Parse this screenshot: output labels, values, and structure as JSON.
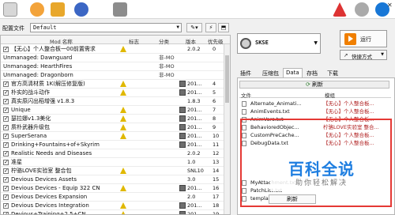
{
  "profile": {
    "label": "配置文件",
    "value": "Default"
  },
  "columns": {
    "name": "Mod 名称",
    "flags": "标志",
    "category": "分类",
    "version": "版本",
    "priority": "优先级"
  },
  "mods": [
    {
      "checked": true,
      "name": "【无心】个人整合板一00前置需求",
      "flag": true,
      "category": "",
      "disk": false,
      "version": "2.0.2",
      "priority": "0"
    },
    {
      "checked": false,
      "sep": true,
      "name": "Unmanaged: Dawnguard",
      "flag": false,
      "category": "非-MO",
      "disk": false,
      "version": "",
      "priority": ""
    },
    {
      "checked": false,
      "sep": true,
      "name": "Unmanaged: HearthFires",
      "flag": false,
      "category": "非-MO",
      "disk": false,
      "version": "",
      "priority": ""
    },
    {
      "checked": false,
      "sep": true,
      "name": "Unmanaged: Dragonborn",
      "flag": false,
      "category": "非-MO",
      "disk": false,
      "version": "",
      "priority": ""
    },
    {
      "checked": true,
      "name": "官方高清材质 1K(解压修复版)",
      "flag": true,
      "category": "",
      "disk": true,
      "version": "201...",
      "priority": "4"
    },
    {
      "checked": true,
      "name": "朴实的战斗动作",
      "flag": true,
      "category": "",
      "disk": true,
      "version": "201...",
      "priority": "5"
    },
    {
      "checked": true,
      "name": "真实原闪出稻增强 v1.8.3",
      "flag": false,
      "category": "",
      "disk": false,
      "version": "1.8.3",
      "priority": "6"
    },
    {
      "checked": true,
      "name": "Unique",
      "flag": true,
      "category": "",
      "disk": true,
      "version": "201...",
      "priority": "7"
    },
    {
      "checked": true,
      "name": "瑟拉娜v1.3美化",
      "flag": true,
      "category": "",
      "disk": true,
      "version": "201...",
      "priority": "8"
    },
    {
      "checked": true,
      "name": "质朴武器升级包",
      "flag": true,
      "category": "",
      "disk": true,
      "version": "201...",
      "priority": "9"
    },
    {
      "checked": true,
      "name": "SuperSerana",
      "flag": true,
      "category": "",
      "disk": true,
      "version": "201...",
      "priority": "10"
    },
    {
      "checked": true,
      "name": "Drinking+Fountains+of+Skyrim",
      "flag": false,
      "category": "",
      "disk": true,
      "version": "201...",
      "priority": "11"
    },
    {
      "checked": true,
      "name": "Realistic Needs and Diseases",
      "flag": false,
      "category": "",
      "disk": false,
      "version": "2.0.2",
      "priority": "12"
    },
    {
      "checked": true,
      "name": "准星",
      "flag": false,
      "category": "",
      "disk": false,
      "version": "1.0",
      "priority": "13"
    },
    {
      "checked": true,
      "name": "柠骆LOVE实验室 整合包",
      "flag": true,
      "category": "",
      "disk": false,
      "version": "SNL10",
      "priority": "14"
    },
    {
      "checked": true,
      "name": "Devious Devices Assets",
      "flag": false,
      "category": "",
      "disk": false,
      "version": "3.0",
      "priority": "15"
    },
    {
      "checked": true,
      "name": "Devious Devices - Equip 322 CN",
      "flag": true,
      "category": "",
      "disk": true,
      "version": "201...",
      "priority": "16"
    },
    {
      "checked": true,
      "name": "Devious Devices Expansion",
      "flag": false,
      "category": "",
      "disk": false,
      "version": "2.0",
      "priority": "17"
    },
    {
      "checked": true,
      "name": "Devious Devices Integration",
      "flag": true,
      "category": "",
      "disk": true,
      "version": "201...",
      "priority": "18"
    },
    {
      "checked": true,
      "name": "Devious+Training+2.5+CN",
      "flag": true,
      "category": "",
      "disk": true,
      "version": "201...",
      "priority": "19"
    }
  ],
  "executable": {
    "name": "SKSE"
  },
  "run_label": "运行",
  "shortcut_label": "快捷方式",
  "tabs": [
    "插件",
    "压缩包",
    "Data",
    "存档",
    "下载"
  ],
  "active_tab": "Data",
  "refresh_label": "刷新",
  "files_header": {
    "file": "文件",
    "mod": "模组"
  },
  "files": [
    {
      "file": "Alternate_Animati...",
      "mod": "【无心】个人整合板..."
    },
    {
      "file": "AnimEvents.txt",
      "mod": "【无心】个人整合板..."
    },
    {
      "file": "AnimVars.txt",
      "mod": "【无心】个人整合板..."
    },
    {
      "file": "BehavioredObjec...",
      "mod": "柠骆LOVE实验室 整合..."
    },
    {
      "file": "CustomPreCache...",
      "mod": "【无心】个人整合板..."
    },
    {
      "file": "DebugData.txt",
      "mod": "【无心】个人整合板..."
    },
    {
      "file": "",
      "mod": ""
    },
    {
      "file": "",
      "mod": ""
    },
    {
      "file": "",
      "mod": ""
    },
    {
      "file": "",
      "mod": ""
    },
    {
      "file": "MyAttachment.txt",
      "mod": ""
    },
    {
      "file": "PatchList.txt",
      "mod": ""
    },
    {
      "file": "templates",
      "mod": ""
    }
  ],
  "watermark": {
    "big": "百科全说",
    "small": "助你轻松解决"
  },
  "context_menu_item": "刷新"
}
